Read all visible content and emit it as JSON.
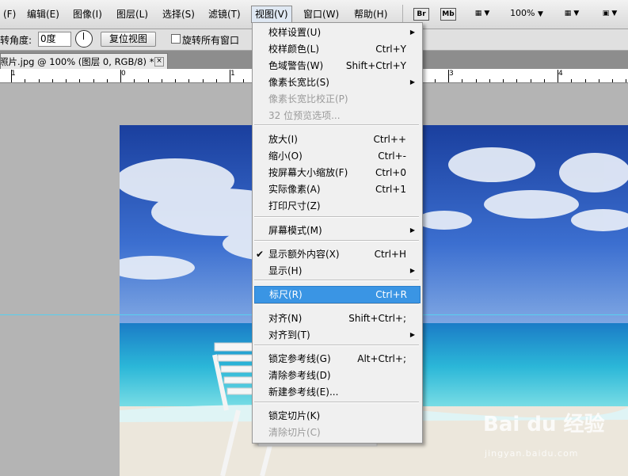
{
  "menubar": {
    "items": [
      "(F)",
      "编辑(E)",
      "图像(I)",
      "图层(L)",
      "选择(S)",
      "滤镜(T)",
      "视图(V)",
      "窗口(W)",
      "帮助(H)"
    ],
    "toolbar": {
      "br": "Br",
      "mb": "Mb",
      "zoom": "100%"
    }
  },
  "options": {
    "angle_label": "旋转角度:",
    "angle_value": "0度",
    "reset_button": "复位视图",
    "rotate_all_label": "旋转所有窗口"
  },
  "document": {
    "tab_title": "照片.jpg @ 100% (图层 0, RGB/8) *",
    "close": "×"
  },
  "ruler": {
    "labels": [
      "1",
      "0",
      "1",
      "2",
      "3",
      "4"
    ]
  },
  "view_menu": {
    "items": [
      {
        "label": "校样设置(U)",
        "shortcut": "",
        "submenu": true
      },
      {
        "label": "校样颜色(L)",
        "shortcut": "Ctrl+Y"
      },
      {
        "label": "色域警告(W)",
        "shortcut": "Shift+Ctrl+Y"
      },
      {
        "label": "像素长宽比(S)",
        "shortcut": "",
        "submenu": true
      },
      {
        "label": "像素长宽比校正(P)",
        "shortcut": "",
        "disabled": true
      },
      {
        "label": "32 位预览选项...",
        "shortcut": "",
        "disabled": true
      },
      {
        "label": "放大(I)",
        "shortcut": "Ctrl++"
      },
      {
        "label": "缩小(O)",
        "shortcut": "Ctrl+-"
      },
      {
        "label": "按屏幕大小缩放(F)",
        "shortcut": "Ctrl+0"
      },
      {
        "label": "实际像素(A)",
        "shortcut": "Ctrl+1"
      },
      {
        "label": "打印尺寸(Z)",
        "shortcut": ""
      },
      {
        "label": "屏幕模式(M)",
        "shortcut": "",
        "submenu": true
      },
      {
        "label": "显示额外内容(X)",
        "shortcut": "Ctrl+H",
        "checked": true
      },
      {
        "label": "显示(H)",
        "shortcut": "",
        "submenu": true
      },
      {
        "label": "标尺(R)",
        "shortcut": "Ctrl+R",
        "highlighted": true
      },
      {
        "label": "对齐(N)",
        "shortcut": "Shift+Ctrl+;"
      },
      {
        "label": "对齐到(T)",
        "shortcut": "",
        "submenu": true
      },
      {
        "label": "锁定参考线(G)",
        "shortcut": "Alt+Ctrl+;"
      },
      {
        "label": "清除参考线(D)",
        "shortcut": ""
      },
      {
        "label": "新建参考线(E)...",
        "shortcut": ""
      },
      {
        "label": "锁定切片(K)",
        "shortcut": ""
      },
      {
        "label": "清除切片(C)",
        "shortcut": "",
        "disabled": true
      }
    ]
  },
  "watermark": {
    "text": "Bai du 经验",
    "url": "jingyan.baidu.com"
  },
  "colors": {
    "highlight": "#3a95e4",
    "guide": "#58d0f0"
  }
}
